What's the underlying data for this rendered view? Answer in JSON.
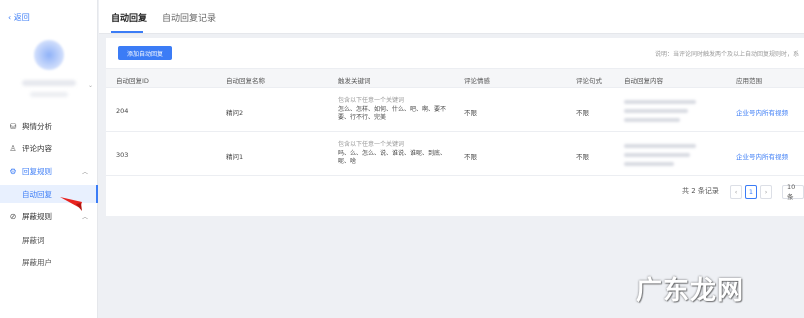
{
  "sidebar": {
    "back_label": "‹ 返回",
    "nav": [
      {
        "label": "舆情分析",
        "icon": "analytics-icon"
      },
      {
        "label": "评论内容",
        "icon": "user-comment-icon"
      },
      {
        "label": "回复规则",
        "icon": "gear-icon"
      },
      {
        "label": "屏蔽规则",
        "icon": "block-icon"
      }
    ],
    "sub_reply": [
      {
        "label": "自动回复"
      }
    ],
    "sub_block": [
      {
        "label": "屏蔽词"
      },
      {
        "label": "屏蔽用户"
      }
    ]
  },
  "tabs": [
    {
      "label": "自动回复"
    },
    {
      "label": "自动回复记录"
    }
  ],
  "toolbar": {
    "add_button": "添加自动回复",
    "note": "说明：当评论同时触发两个及以上自动回复规则时，系"
  },
  "table": {
    "headers": [
      "自动回复ID",
      "自动回复名称",
      "触发关键词",
      "评论情感",
      "评论句式",
      "自动回复内容",
      "应用范围"
    ],
    "rows": [
      {
        "id": "204",
        "name": "精问2",
        "kw_title": "包含以下任意一个关键词",
        "kw_line1": "怎么、怎样、如何、什么、吧、啊、要不",
        "kw_line2": "要、行不行、完美",
        "sentiment": "不限",
        "form": "不限",
        "scope": "企业号内所有视频"
      },
      {
        "id": "303",
        "name": "精问1",
        "kw_title": "包含以下任意一个关键词",
        "kw_line1": "吗、么、怎么、说、谁说、谁呢、到底、",
        "kw_line2": "呢、啥",
        "sentiment": "不限",
        "form": "不限",
        "scope": "企业号内所有视频"
      }
    ]
  },
  "pagination": {
    "total": "共 2 条记录",
    "prev": "‹",
    "page": "1",
    "next": "›",
    "size": "10 条"
  },
  "watermark": "广东龙网",
  "colors": {
    "accent": "#3b7cf6",
    "arrow": "#e8231f"
  }
}
